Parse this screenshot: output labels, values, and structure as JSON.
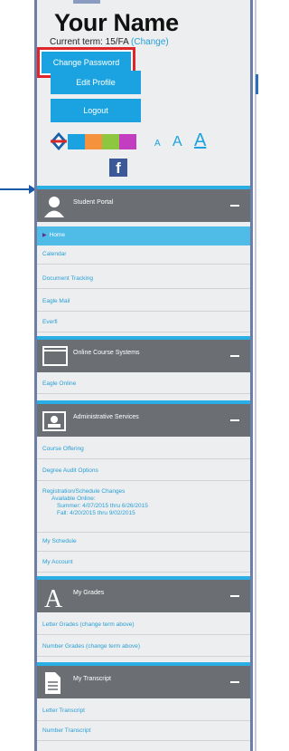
{
  "profile": {
    "name": "Your Name",
    "term_label": "Current term: 15/FA",
    "change_link": "(Change)"
  },
  "buttons": {
    "edit_profile": "Edit Profile",
    "change_password": "Change Password",
    "logout": "Logout"
  },
  "theme": {
    "swatch_colors": [
      "#1aa3e0",
      "#f5923e",
      "#8dc63f",
      "#c23dbf"
    ],
    "font_sizes": [
      "A",
      "A",
      "A"
    ]
  },
  "sections": [
    {
      "title": "Student Portal",
      "icon": "person-icon",
      "items": [
        "Home",
        "Calendar",
        "Document Tracking",
        "Eagle Mail",
        "Everfi"
      ]
    },
    {
      "title": "Online Course Systems",
      "icon": "window-icon",
      "items": [
        "Eagle Online"
      ]
    },
    {
      "title": "Administrative Services",
      "icon": "admin-icon",
      "items": [
        "Course Offering",
        "Degree Audit Options",
        "Registration/Schedule Changes",
        "My Schedule",
        "My Account"
      ],
      "registration_details": [
        "Available Online:",
        "Summer:  4/07/2015 thru 6/26/2015",
        "Fall:  4/20/2015 thru 9/02/2015"
      ]
    },
    {
      "title": "My Grades",
      "icon": "letter-a-icon",
      "items": [
        "Letter Grades   (change term above)",
        "Number Grades   (change term above)"
      ]
    },
    {
      "title": "My Transcript",
      "icon": "document-icon",
      "items": [
        "Letter Transcript",
        "Number Transcript"
      ]
    }
  ],
  "colors": {
    "accent": "#1aa3e0",
    "header_bg": "#6b6f73",
    "highlight": "#e0262a",
    "active_item": "#4fbce8"
  }
}
